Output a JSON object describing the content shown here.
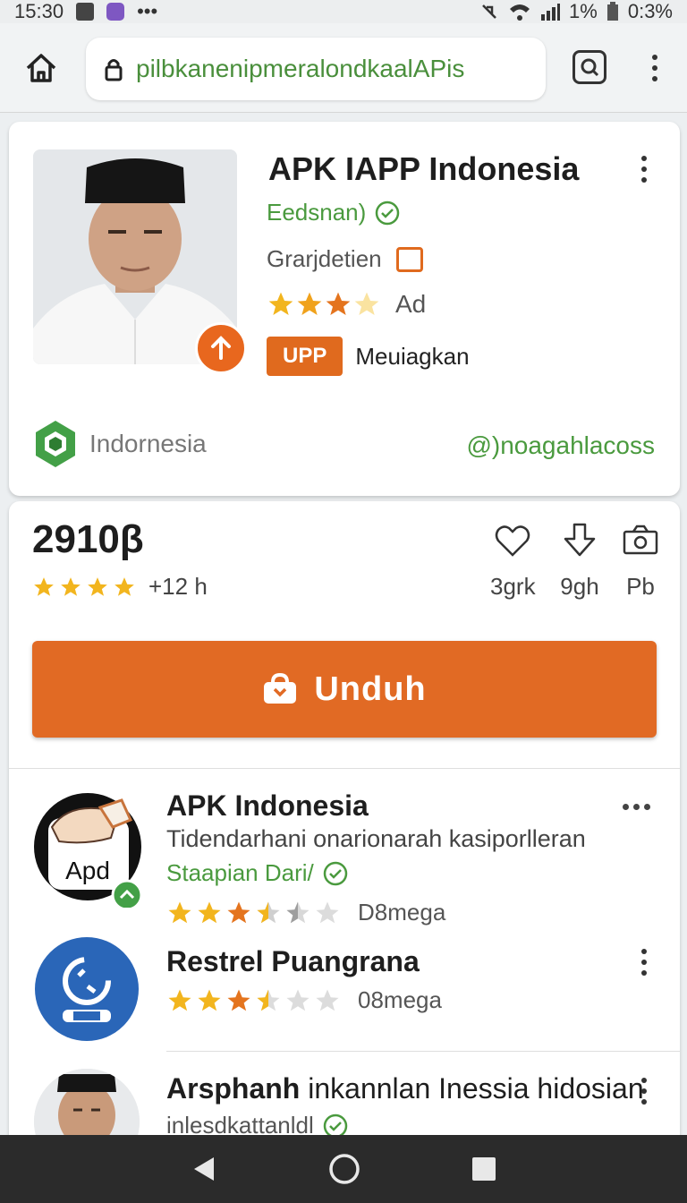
{
  "status_bar": {
    "time": "15:30",
    "more": "•••",
    "battery_text": "1%",
    "data_text": "0:3%"
  },
  "browser": {
    "url": "pilbkanenipmeralondkaalAPis"
  },
  "app_card": {
    "title": "APK IAPP Indonesia",
    "developer": "Eedsnan)",
    "category": "Grarjdetien",
    "rating_stars": 3,
    "ad_label": "Ad",
    "badge": "UPP",
    "badge_text": "Meuiagkan",
    "country": "Indornesia",
    "handle": "@)noagahlacoss",
    "accent_color": "#e06a1e",
    "green_color": "#4a9a3e"
  },
  "summary": {
    "rating_big": "2910β",
    "rating_time": "+12 h",
    "stats": [
      {
        "icon": "heart-icon",
        "label": "3grk"
      },
      {
        "icon": "download-arrow-icon",
        "label": "9gh"
      },
      {
        "icon": "camera-icon",
        "label": "Pb"
      }
    ]
  },
  "download": {
    "label": "Unduh",
    "color": "#e16a24"
  },
  "list": [
    {
      "title": "APK Indonesia",
      "description": "Tidendarhani onarionarah kasiporlleran",
      "developer": "Staapian Dari/",
      "rating": 3.5,
      "meta": "D8mega",
      "icon_text": "Apd"
    },
    {
      "title": "Restrel Puangrana",
      "rating": 3.5,
      "meta": "08mega"
    },
    {
      "title_bold": "Arsphanh",
      "title_rest": " inkannlan Inessia hidosian",
      "developer": "inlesdkattanldl"
    }
  ]
}
